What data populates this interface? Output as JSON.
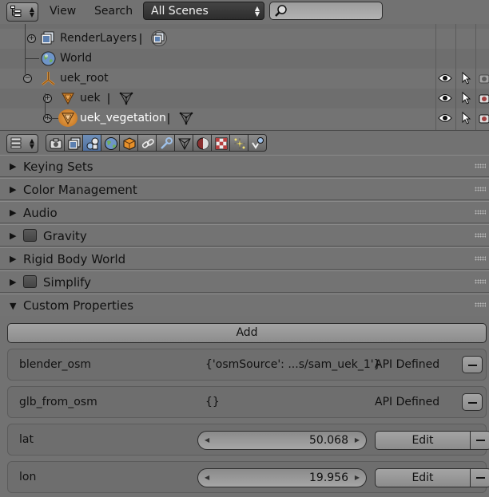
{
  "outliner": {
    "menu": {
      "view": "View",
      "search": "Search"
    },
    "scene_select": {
      "value": "All Scenes"
    },
    "search": {
      "placeholder": ""
    },
    "items": {
      "render_layers": "RenderLayers",
      "world": "World",
      "uek_root": "uek_root",
      "uek": "uek",
      "uek_vegetation": "uek_vegetation"
    },
    "icons": [
      "render-layers-icon",
      "world-icon",
      "empty-object-icon",
      "mesh-object-icon",
      "mesh-data-icon",
      "eye-icon",
      "cursor-icon",
      "camera-icon"
    ]
  },
  "properties": {
    "context_tabs": [
      "render",
      "render-layers",
      "scene",
      "world",
      "object",
      "constraints",
      "modifiers",
      "data",
      "material",
      "texture",
      "particles",
      "physics"
    ],
    "active_tab": "scene",
    "panels": {
      "keying_sets": "Keying Sets",
      "color_management": "Color Management",
      "audio": "Audio",
      "gravity": "Gravity",
      "rigid_body_world": "Rigid Body World",
      "simplify": "Simplify",
      "custom_properties": "Custom Properties"
    },
    "custom_properties": {
      "add_label": "Add",
      "items": [
        {
          "key": "blender_osm",
          "value": "{'osmSource': ...s/sam_uek_1'}",
          "api": "API Defined"
        },
        {
          "key": "glb_from_osm",
          "value": "{}",
          "api": "API Defined"
        },
        {
          "key": "lat",
          "value": "50.068",
          "edit": "Edit"
        },
        {
          "key": "lon",
          "value": "19.956",
          "edit": "Edit"
        }
      ]
    }
  }
}
